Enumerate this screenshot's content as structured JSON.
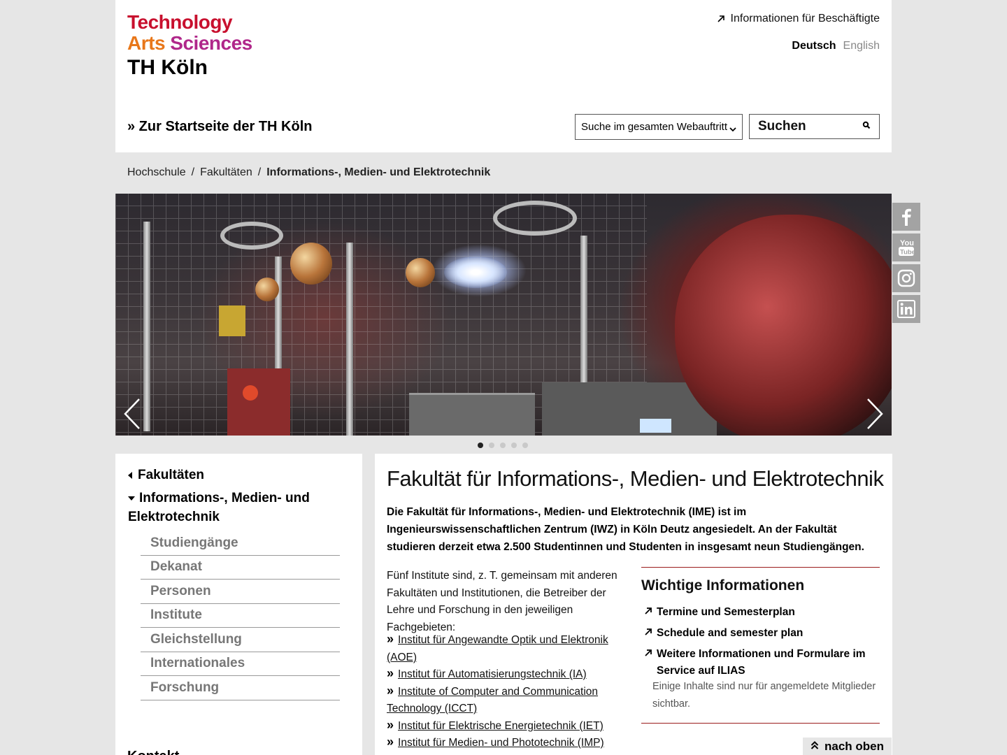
{
  "logo": {
    "line1": "Technology",
    "line2a": "Arts",
    "line2b": "Sciences",
    "line3": "TH Köln"
  },
  "header": {
    "employee_link": "Informationen für Beschäftigte",
    "lang_de": "Deutsch",
    "lang_en": "English",
    "home_link": "» Zur Startseite der TH Köln",
    "search_scope": "Suche im gesamten Webauftritt",
    "search_placeholder": "Suchen"
  },
  "breadcrumb": {
    "items": [
      "Hochschule",
      "Fakultäten",
      "Informations-, Medien- und Elektrotechnik"
    ],
    "separator": "/"
  },
  "slider": {
    "dot_count": 5,
    "active_index": 0
  },
  "social": [
    "facebook-icon",
    "youtube-icon",
    "instagram-icon",
    "linkedin-icon"
  ],
  "sidenav": {
    "parent": "Fakultäten",
    "current": "Informations-, Medien- und Elektrotechnik",
    "items": [
      "Studiengänge",
      "Dekanat",
      "Personen",
      "Institute",
      "Gleichstellung",
      "Internationales",
      "Forschung"
    ],
    "next_heading": "Kontakt"
  },
  "main": {
    "title": "Fakultät für Informations-, Medien- und Elektrotechnik",
    "lead": "Die Fakultät für Informations-, Medien- und Elektrotechnik (IME) ist im Ingenieurswissenschaftlichen Zentrum (IWZ) in Köln Deutz angesiedelt. An der Fakultät studieren derzeit etwa 2.500 Studentinnen und Studenten in insgesamt neun Studiengängen.",
    "intro": "Fünf Institute sind, z. T. gemeinsam mit anderen Fakultäten und Institutionen, die Betreiber der Lehre und Forschung in den jeweiligen Fachgebieten:",
    "institutes": [
      "Institut für Angewandte Optik und Elektronik (AOE)",
      "Institut für Automatisierungstechnik (IA)",
      "Institute of Computer and Communication Technology (ICCT)",
      "Institut für Elektrische Energietechnik (IET)",
      "Institut für Medien- und Phototechnik (IMP)"
    ]
  },
  "info_box": {
    "heading": "Wichtige Informationen",
    "links": [
      "Termine und Semesterplan",
      "Schedule and semester plan",
      "Weitere Informationen und Formulare im Service auf ILIAS"
    ],
    "note": "Einige Inhalte sind nur für angemeldete Mitglieder sichtbar."
  },
  "to_top": "nach oben",
  "colors": {
    "brand_red": "#c8102e",
    "brand_orange": "#e8771a",
    "brand_purple": "#b0278a",
    "divider_red": "#9b1c1c"
  }
}
